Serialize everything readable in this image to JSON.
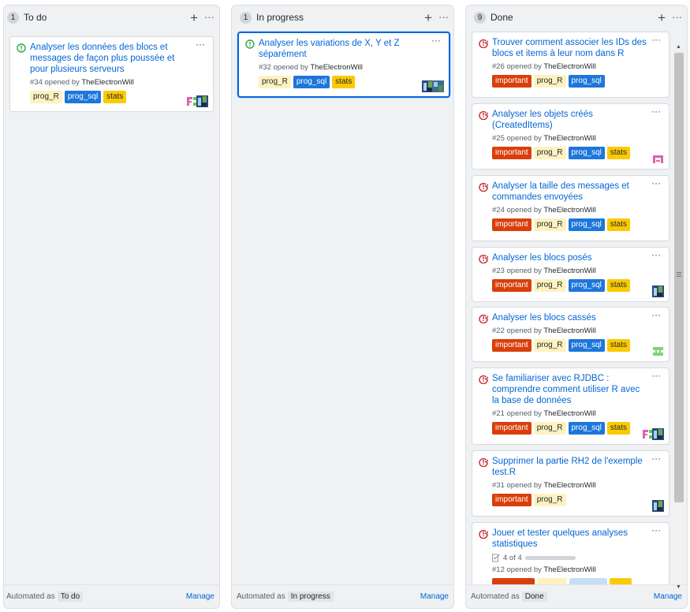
{
  "columns": [
    {
      "count": "1",
      "name": "To do",
      "automated_label": "Automated as",
      "automated_name": "To do",
      "manage": "Manage",
      "cards": [
        {
          "title": "Analyser les données des blocs et messages de façon plus poussée et pour plusieurs serveurs",
          "number": "#34",
          "opened": "opened by",
          "author": "TheElectronWill",
          "labels": [
            "prog_R",
            "prog_sql",
            "stats"
          ],
          "state": "open"
        }
      ]
    },
    {
      "count": "1",
      "name": "In progress",
      "automated_label": "Automated as",
      "automated_name": "In progress",
      "manage": "Manage",
      "cards": [
        {
          "title": "Analyser les variations de X, Y et Z séparément",
          "number": "#32",
          "opened": "opened by",
          "author": "TheElectronWill",
          "labels": [
            "prog_R",
            "prog_sql",
            "stats"
          ],
          "state": "open"
        }
      ]
    },
    {
      "count": "9",
      "name": "Done",
      "automated_label": "Automated as",
      "automated_name": "Done",
      "manage": "Manage",
      "cards": [
        {
          "title": "Trouver comment associer les IDs des blocs et items à leur nom dans R",
          "number": "#26",
          "opened": "opened by",
          "author": "TheElectronWill",
          "labels": [
            "important",
            "prog_R",
            "prog_sql"
          ],
          "state": "closed"
        },
        {
          "title": "Analyser les objets créés (CreatedItems)",
          "number": "#25",
          "opened": "opened by",
          "author": "TheElectronWill",
          "labels": [
            "important",
            "prog_R",
            "prog_sql",
            "stats"
          ],
          "state": "closed"
        },
        {
          "title": "Analyser la taille des messages et commandes envoyées",
          "number": "#24",
          "opened": "opened by",
          "author": "TheElectronWill",
          "labels": [
            "important",
            "prog_R",
            "prog_sql",
            "stats"
          ],
          "state": "closed"
        },
        {
          "title": "Analyser les blocs posés",
          "number": "#23",
          "opened": "opened by",
          "author": "TheElectronWill",
          "labels": [
            "important",
            "prog_R",
            "prog_sql",
            "stats"
          ],
          "state": "closed"
        },
        {
          "title": "Analyser les blocs cassés",
          "number": "#22",
          "opened": "opened by",
          "author": "TheElectronWill",
          "labels": [
            "important",
            "prog_R",
            "prog_sql",
            "stats"
          ],
          "state": "closed"
        },
        {
          "title": "Se familiariser avec RJDBC : comprendre comment utiliser R avec la base de données",
          "number": "#21",
          "opened": "opened by",
          "author": "TheElectronWill",
          "labels": [
            "important",
            "prog_R",
            "prog_sql",
            "stats"
          ],
          "state": "closed"
        },
        {
          "title": "Supprimer la partie RH2 de l'exemple test.R",
          "number": "#31",
          "opened": "opened by",
          "author": "TheElectronWill",
          "labels": [
            "important",
            "prog_R"
          ],
          "state": "closed"
        },
        {
          "title": "Jouer et tester quelques analyses statistiques",
          "number": "#12",
          "opened": "opened by",
          "author": "TheElectronWill",
          "labels": [],
          "state": "closed",
          "progress": "4 of 4"
        }
      ]
    }
  ],
  "colors": {
    "important": "#d93f0b",
    "prog_R": "#fef2c0",
    "prog_sql": "#1d76db",
    "stats": "#fbca04",
    "link": "#0366d6"
  }
}
